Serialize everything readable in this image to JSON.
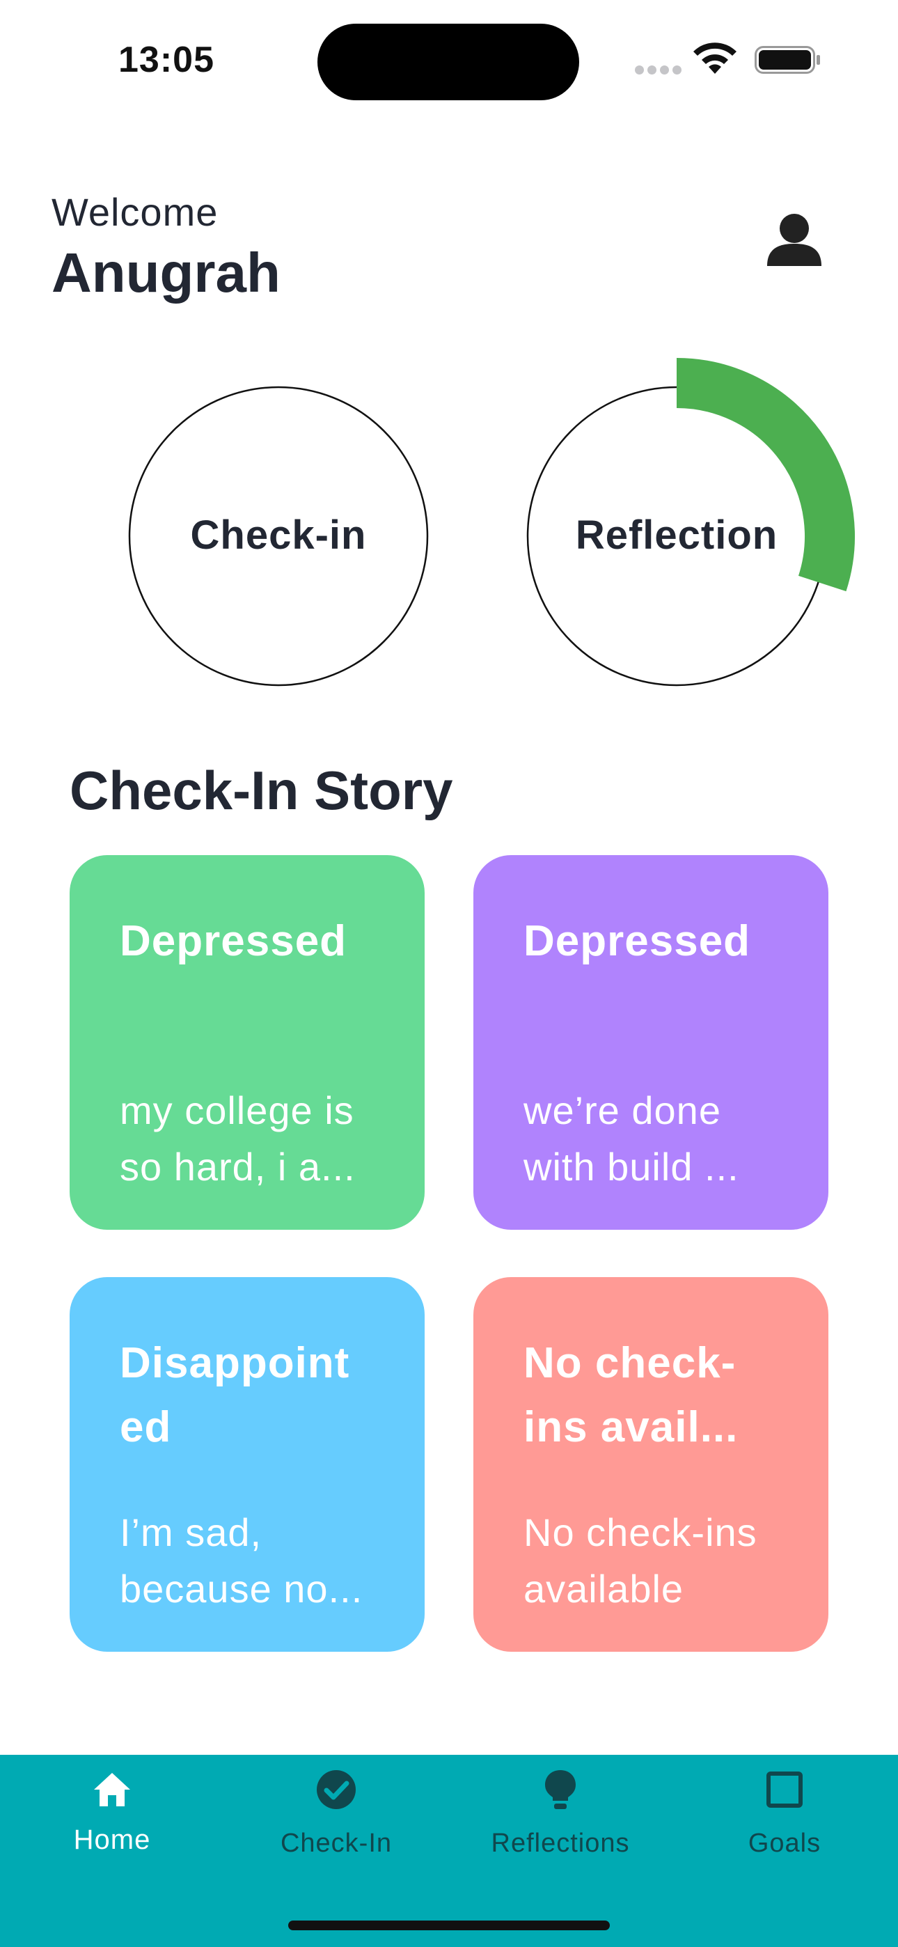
{
  "status_bar": {
    "time": "13:05"
  },
  "header": {
    "greeting": "Welcome",
    "user_name": "Anugrah",
    "profile_icon": "person-icon"
  },
  "progress": {
    "checkin": {
      "label": "Check-in",
      "fraction": 0.0,
      "color": "#4caf50"
    },
    "reflection": {
      "label": "Reflection",
      "fraction": 0.3,
      "color": "#4caf50"
    }
  },
  "story": {
    "title": "Check-In Story",
    "cards": [
      {
        "title": "Depressed",
        "text": "my college is so hard, i a...",
        "color": "#66db95"
      },
      {
        "title": "Depressed",
        "text": "we’re done with build ...",
        "color": "#b083fd"
      },
      {
        "title": "Disappoint ed",
        "text": "I’m sad, because no...",
        "color": "#66ccfe"
      },
      {
        "title": "No check-ins avail...",
        "text": "No check-ins available",
        "color": "#ff9a95"
      }
    ]
  },
  "nav": {
    "background": "#00aab3",
    "items": [
      {
        "label": "Home",
        "icon": "home-icon",
        "active": true
      },
      {
        "label": "Check-In",
        "icon": "check-circle-icon",
        "active": false
      },
      {
        "label": "Reflections",
        "icon": "lightbulb-icon",
        "active": false
      },
      {
        "label": "Goals",
        "icon": "square-icon",
        "active": false
      }
    ]
  }
}
